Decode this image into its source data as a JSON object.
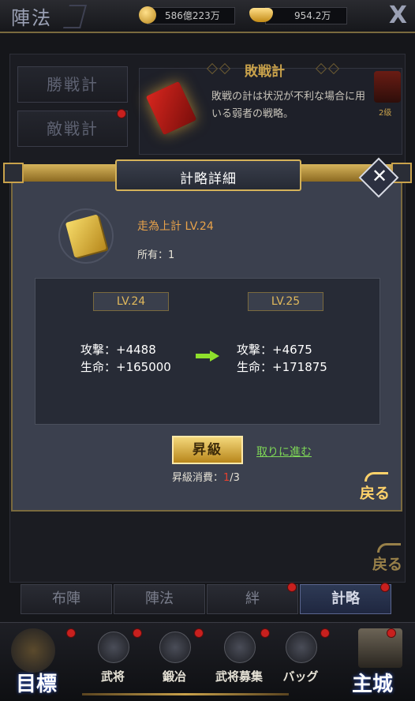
{
  "topbar": {
    "title": "陣法",
    "coins": "586億223万",
    "ingots": "954.2万",
    "close": "X"
  },
  "background": {
    "side_tabs": [
      "勝戦計",
      "敵戦計"
    ],
    "info_title": "敗戦計",
    "info_desc": "敗戦の計は状況が不利な場合に用いる弱者の戦略。",
    "mini_label": "2级",
    "back": "戻る"
  },
  "modal": {
    "title": "計略詳細",
    "item_name": "走為上計 LV.24",
    "own_label": "所有：1",
    "current": {
      "level": "LV.24",
      "attack": "攻撃：+4488",
      "hp": "生命：+165000"
    },
    "next": {
      "level": "LV.25",
      "attack": "攻撃：+4675",
      "hp": "生命：+171875"
    },
    "upgrade_label": "昇級",
    "goto_label": "取りに進む",
    "cost_prefix": "昇級消費：",
    "cost_have": "1",
    "cost_need": "/3",
    "back": "戻る"
  },
  "tabs": [
    "布陣",
    "陣法",
    "絆",
    "計略"
  ],
  "nav": {
    "goal": "目標",
    "items": [
      "武将",
      "鍛冶",
      "武将募集",
      "バッグ"
    ],
    "castle": "主城"
  },
  "colors": {
    "accent_gold": "#c9a24b",
    "link_green": "#7fd957",
    "alert_red": "#c8201e"
  }
}
